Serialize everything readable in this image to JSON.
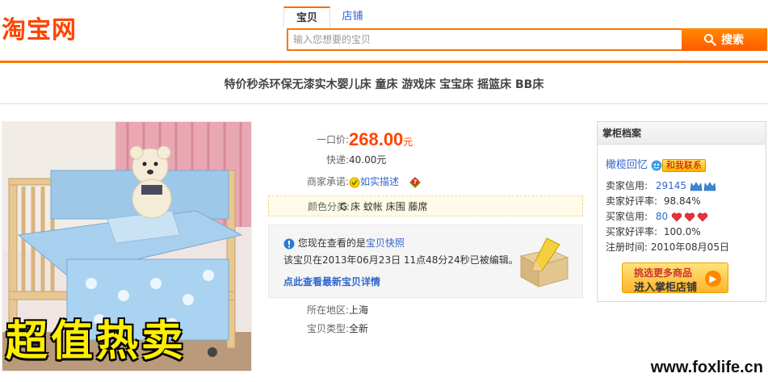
{
  "header": {
    "logo": "淘宝网",
    "tabs": [
      {
        "label": "宝贝",
        "active": true
      },
      {
        "label": "店铺",
        "active": false
      }
    ],
    "search": {
      "placeholder": "输入您想要的宝贝",
      "value": "",
      "button_label": "搜索"
    }
  },
  "product": {
    "title": "特价秒杀环保无漆实木婴儿床 童床 游戏床 宝宝床 摇篮床 BB床",
    "promo_banner": "超值热卖",
    "price_label": "一口价:",
    "price": "268.00",
    "price_unit": "元",
    "shipping_label": "快递:",
    "shipping": "40.00元",
    "promise_label": "商家承诺:",
    "promise_text": "如实描述",
    "color_label": "颜色分类:",
    "color_value": "G 床 蚊帐 床围 藤席",
    "snapshot_notice": {
      "line1_prefix": "您现在查看的是",
      "line1_link": "宝贝快照",
      "line2": "该宝贝在2013年06月23日 11点48分24秒已被编辑。",
      "line3_link": "点此查看最新宝贝详情"
    },
    "location_label": "所在地区:",
    "location": "上海",
    "type_label": "宝贝类型:",
    "type": "全新"
  },
  "seller": {
    "header": "掌柜档案",
    "name": "橄榄回忆",
    "contact_label": "和我联系",
    "seller_credit_label": "卖家信用:",
    "seller_credit": "29145",
    "seller_rate_label": "卖家好评率:",
    "seller_rate": "98.84%",
    "buyer_credit_label": "买家信用:",
    "buyer_credit": "80",
    "buyer_rate_label": "买家好评率:",
    "buyer_rate": "100.0%",
    "register_label": "注册时间:",
    "register_date": "2010年08月05日",
    "enter_shop_line1": "挑选更多商品",
    "enter_shop_line2": "进入掌柜店铺"
  },
  "watermark": "www.foxlife.cn",
  "colors": {
    "accent": "#ff7300",
    "price": "#ff4400",
    "link": "#3366cc"
  },
  "icons": [
    "search-icon",
    "info-icon",
    "promise-icon",
    "seven-day-return-icon",
    "wangwang-icon",
    "crown-icon",
    "heart-icon",
    "arrow-right-icon"
  ]
}
